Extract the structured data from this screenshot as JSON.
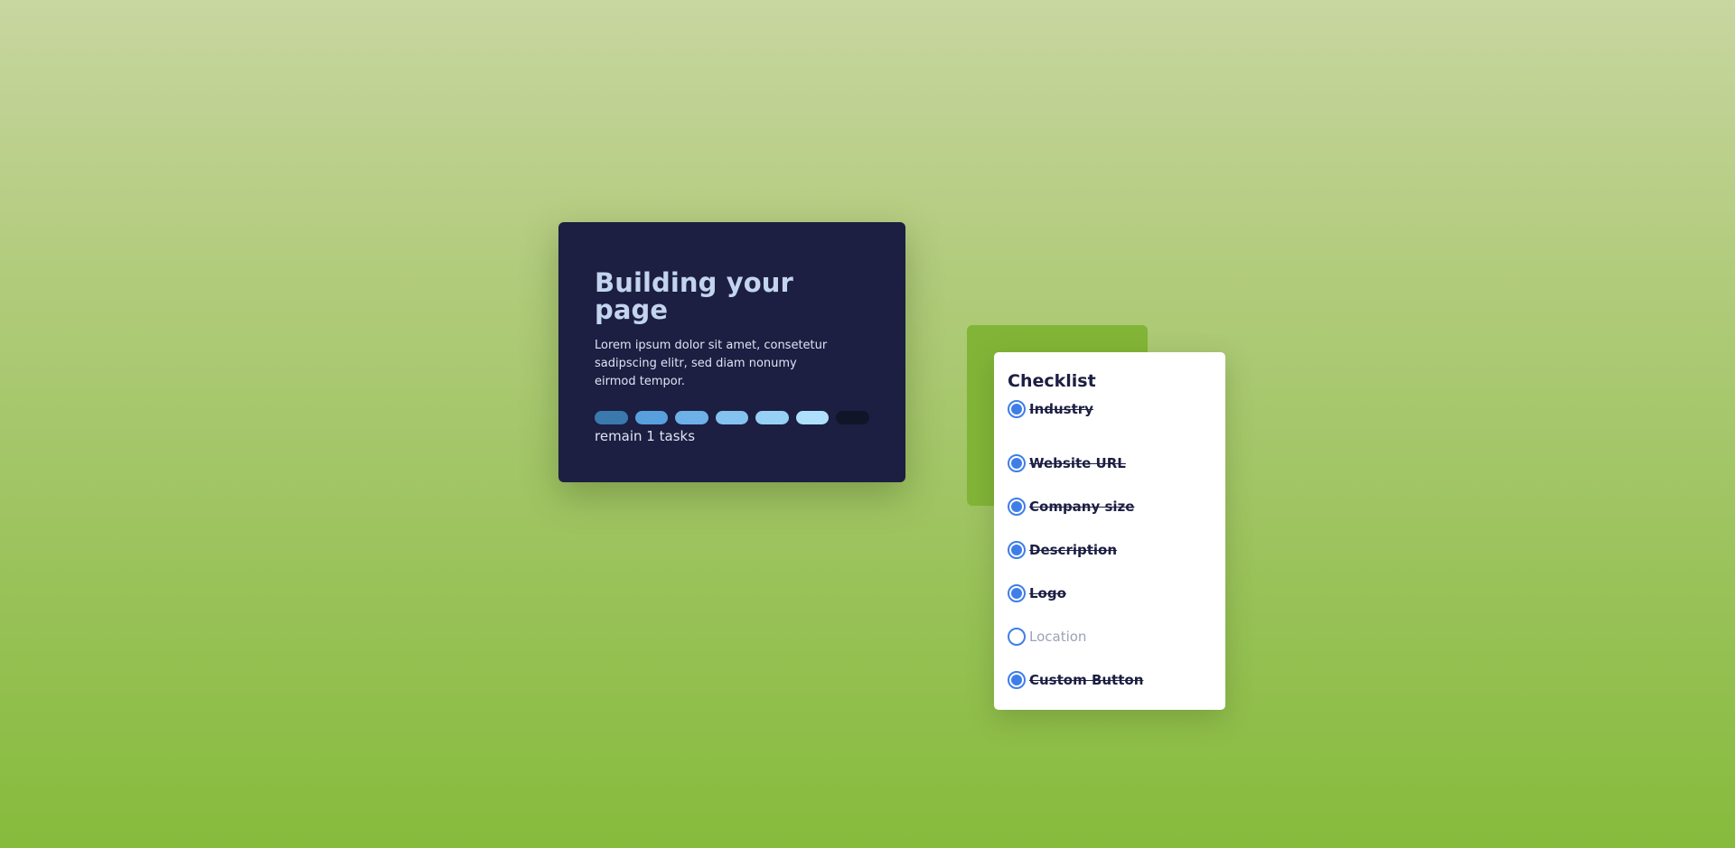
{
  "progress_card": {
    "title": "Building your page",
    "description": "Lorem ipsum dolor sit amet, consetetur sadipscing elitr, sed diam nonumy eirmod tempor.",
    "remaining_text": "remain 1 tasks",
    "segment_colors": [
      "#3a79ad",
      "#58a0dd",
      "#6eb1e8",
      "#84c2ef",
      "#97d0f5",
      "#afe0fb",
      "#111528"
    ]
  },
  "checklist": {
    "title": "Checklist",
    "items": [
      {
        "label": "Industry",
        "done": true
      },
      {
        "label": "Website URL",
        "done": true
      },
      {
        "label": "Company size",
        "done": true
      },
      {
        "label": "Description",
        "done": true
      },
      {
        "label": "Logo",
        "done": true
      },
      {
        "label": "Location",
        "done": false
      },
      {
        "label": "Custom Button",
        "done": true
      }
    ]
  },
  "colors": {
    "card_background": "#1c1e42",
    "accent_block": "#82b537",
    "checkbox_accent": "#3f7ee8"
  }
}
